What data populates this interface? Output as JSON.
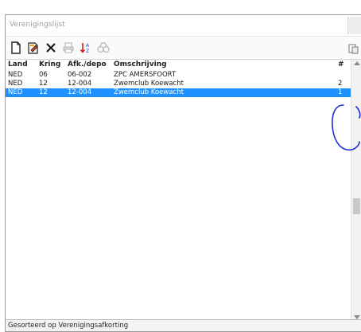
{
  "window": {
    "title": "Verenigingslijst"
  },
  "toolbar": {
    "icons": [
      "new-document-icon",
      "edit-document-icon",
      "delete-icon",
      "print-icon",
      "sort-icon",
      "binoculars-icon",
      "export-icon"
    ]
  },
  "table": {
    "headers": {
      "land": "Land",
      "kring": "Kring",
      "afk": "Afk./depo",
      "oms": "Omschrijving",
      "num": "#"
    },
    "rows": [
      {
        "land": "NED",
        "kring": "06",
        "afk": "06-002",
        "oms": "ZPC AMERSFOORT",
        "num": ""
      },
      {
        "land": "NED",
        "kring": "12",
        "afk": "12-004",
        "oms": "Zwemclub Koewacht",
        "num": "2"
      },
      {
        "land": "NED",
        "kring": "12",
        "afk": "12-004",
        "oms": "Zwemclub Koewacht",
        "num": "1"
      }
    ],
    "selected_row_index": 2
  },
  "statusbar": {
    "text": "Gesorteerd op Verenigingsafkorting"
  },
  "colors": {
    "selection": "#1e90ff",
    "annotation": "#1a2fd6"
  }
}
